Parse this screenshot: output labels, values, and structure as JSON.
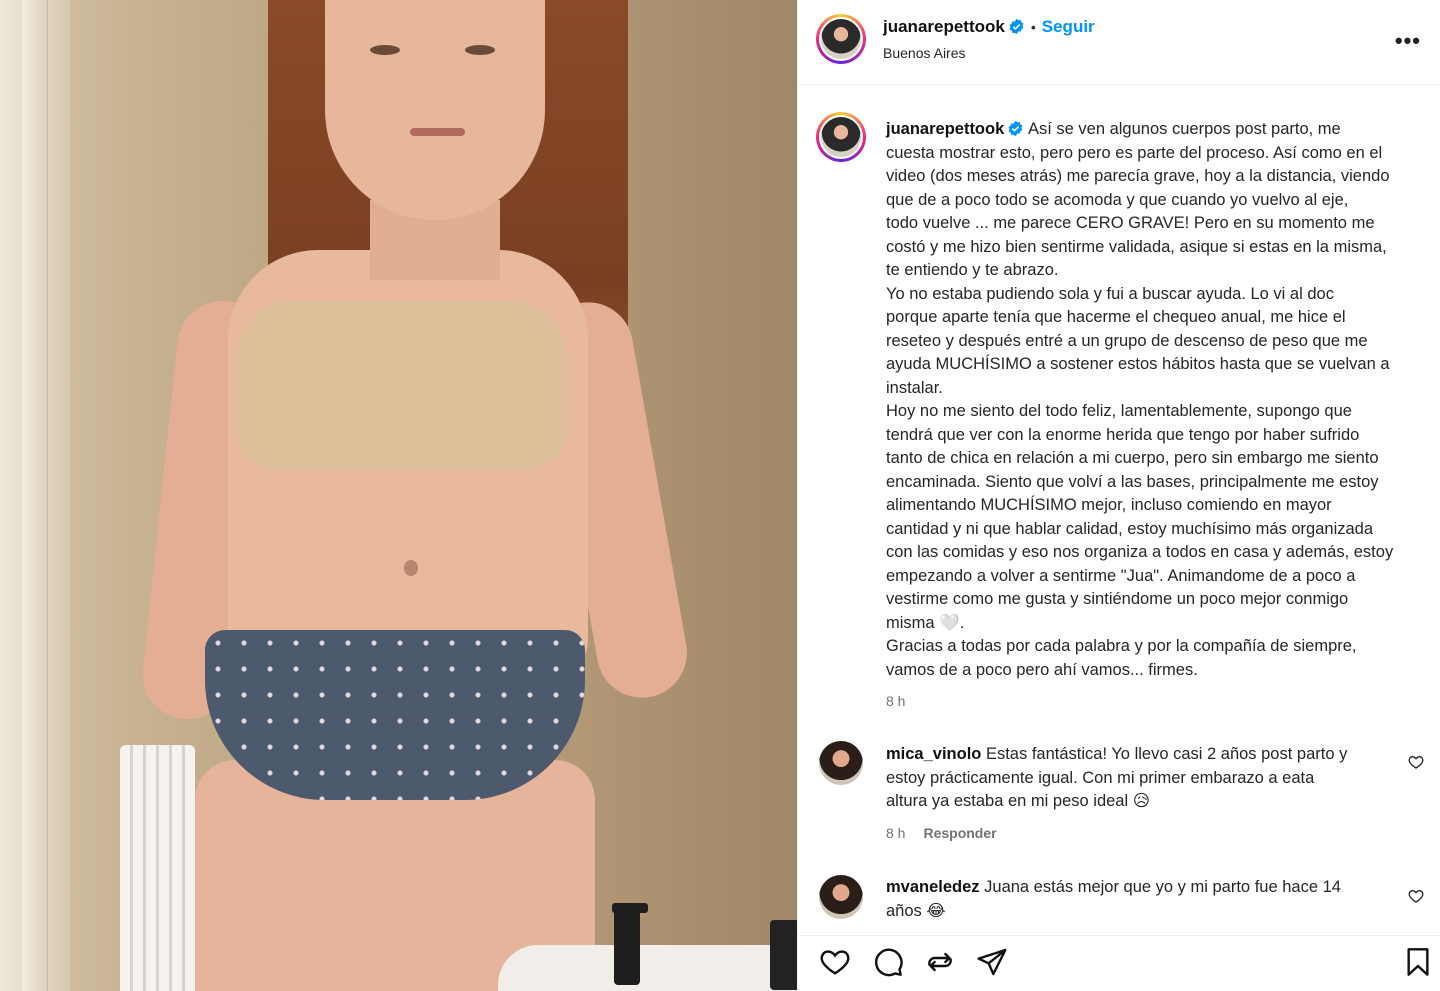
{
  "post": {
    "username": "juanarepettook",
    "follow_label": "Seguir",
    "separator": "•",
    "location": "Buenos Aires",
    "more_label": "•••",
    "caption_lines": [
      "Así se ven algunos cuerpos post parto, me",
      "cuesta mostrar esto, pero pero es parte del proceso. Así como en el",
      "video (dos meses atrás) me parecía grave, hoy a la distancia, viendo",
      "que de a poco todo se acomoda y que cuando yo vuelvo al eje,",
      "todo vuelve ... me parece CERO GRAVE! Pero en su momento me",
      "costó y me hizo bien sentirme validada, asique si estas en la misma,",
      "te entiendo y te abrazo.",
      "Yo no estaba pudiendo sola y fui a buscar ayuda. Lo vi al doc",
      "porque aparte tenía que hacerme el chequeo anual, me hice el",
      "reseteo y después entré a un grupo de descenso de peso que me",
      "ayuda MUCHÍSIMO a sostener estos hábitos hasta que se vuelvan a",
      "instalar.",
      "Hoy no me siento del todo feliz, lamentablemente, supongo que",
      "tendrá que ver con la enorme herida que tengo por haber sufrido",
      "tanto de chica en relación a mi cuerpo, pero sin embargo me siento",
      "encaminada. Siento que volví a las bases, principalmente me estoy",
      "alimentando MUCHÍSIMO mejor, incluso comiendo en mayor",
      "cantidad y ni que hablar calidad, estoy muchísimo más organizada",
      "con las comidas y eso nos organiza a todos en casa y además, estoy",
      "empezando a volver a sentirme \"Jua\". Animandome de a poco a",
      "vestirme como me gusta y sintiéndome un poco mejor conmigo",
      "misma 🤍.",
      "Gracias a todas por cada palabra y por la compañía de siempre,",
      "vamos de a poco pero ahí vamos... firmes."
    ],
    "caption_time": "8 h"
  },
  "comments": [
    {
      "username": "mica_vinolo",
      "lines": [
        "Estas fantástica! Yo llevo casi 2 años post parto y",
        "estoy prácticamente igual. Con mi primer embarazo a eata",
        "altura ya estaba en mi peso ideal 😥"
      ],
      "time": "8 h",
      "reply_label": "Responder"
    },
    {
      "username": "mvaneledez",
      "lines": [
        "Juana estás mejor que yo y mi parto fue hace 14",
        "años 😂"
      ]
    }
  ],
  "icons": {
    "like": "heart-icon",
    "comment": "comment-icon",
    "share": "share-icon",
    "send": "send-icon",
    "save": "bookmark-icon",
    "verified": "verified-badge-icon"
  },
  "colors": {
    "accent": "#0095f6",
    "secondary_text": "#737373"
  }
}
